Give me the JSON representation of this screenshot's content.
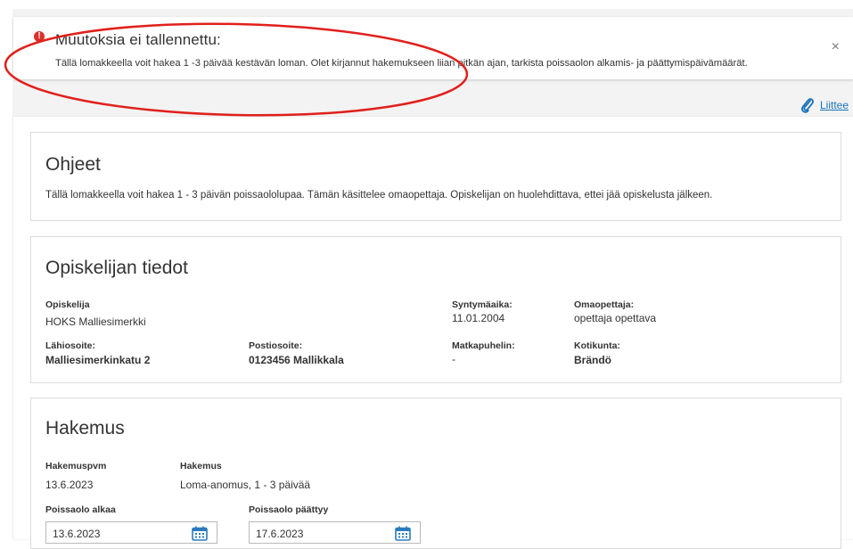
{
  "alert": {
    "title": "Muutoksia ei tallennettu:",
    "message": "Tällä lomakkeella voit hakea 1 -3 päivää kestävän loman. Olet kirjannut hakemukseen liian pitkän ajan, tarkista poissaolon alkamis- ja päättymispäivämäärät.",
    "close": "×",
    "icon_symbol": "!"
  },
  "attachments": {
    "label": "Liittee"
  },
  "instructions": {
    "title": "Ohjeet",
    "text": "Tällä lomakkeella voit hakea 1 - 3 päivän poissaololupaa. Tämän käsittelee omaopettaja. Opiskelijan on huolehdittava, ettei jää opiskelusta jälkeen."
  },
  "student": {
    "title": "Opiskelijan tiedot",
    "student_label": "Opiskelija",
    "student_value": "HOKS Malliesimerkki",
    "birth_label": "Syntymäaika:",
    "birth_value": "11.01.2004",
    "teacher_label": "Omaopettaja:",
    "teacher_value": "opettaja opettava",
    "address_label": "Lähiosoite:",
    "address_value": "Malliesimerkinkatu 2",
    "postal_label": "Postiosoite:",
    "postal_value": "0123456 Mallikkala",
    "phone_label": "Matkapuhelin:",
    "phone_value": "-",
    "municipality_label": "Kotikunta:",
    "municipality_value": "Brändö"
  },
  "application": {
    "title": "Hakemus",
    "date_label": "Hakemuspvm",
    "date_value": "13.6.2023",
    "type_label": "Hakemus",
    "type_value": "Loma-anomus, 1 - 3 päivää",
    "start_label": "Poissaolo alkaa",
    "start_value": "13.6.2023",
    "end_label": "Poissaolo päättyy",
    "end_value": "17.6.2023"
  },
  "colors": {
    "error": "#d8312c",
    "link": "#1a73b8",
    "annotation": "#e0201c",
    "calendar": "#2b7bbf"
  }
}
